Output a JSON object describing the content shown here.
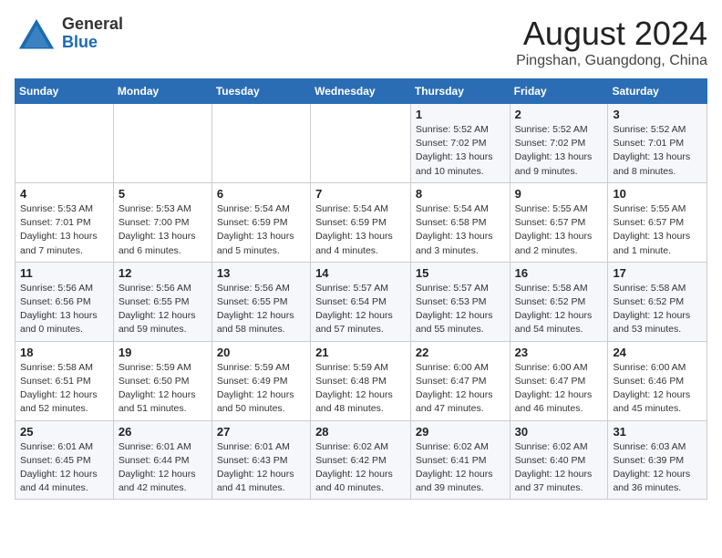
{
  "header": {
    "logo_general": "General",
    "logo_blue": "Blue",
    "title": "August 2024",
    "subtitle": "Pingshan, Guangdong, China"
  },
  "weekdays": [
    "Sunday",
    "Monday",
    "Tuesday",
    "Wednesday",
    "Thursday",
    "Friday",
    "Saturday"
  ],
  "weeks": [
    [
      {
        "day": "",
        "detail": ""
      },
      {
        "day": "",
        "detail": ""
      },
      {
        "day": "",
        "detail": ""
      },
      {
        "day": "",
        "detail": ""
      },
      {
        "day": "1",
        "detail": "Sunrise: 5:52 AM\nSunset: 7:02 PM\nDaylight: 13 hours and 10 minutes."
      },
      {
        "day": "2",
        "detail": "Sunrise: 5:52 AM\nSunset: 7:02 PM\nDaylight: 13 hours and 9 minutes."
      },
      {
        "day": "3",
        "detail": "Sunrise: 5:52 AM\nSunset: 7:01 PM\nDaylight: 13 hours and 8 minutes."
      }
    ],
    [
      {
        "day": "4",
        "detail": "Sunrise: 5:53 AM\nSunset: 7:01 PM\nDaylight: 13 hours and 7 minutes."
      },
      {
        "day": "5",
        "detail": "Sunrise: 5:53 AM\nSunset: 7:00 PM\nDaylight: 13 hours and 6 minutes."
      },
      {
        "day": "6",
        "detail": "Sunrise: 5:54 AM\nSunset: 6:59 PM\nDaylight: 13 hours and 5 minutes."
      },
      {
        "day": "7",
        "detail": "Sunrise: 5:54 AM\nSunset: 6:59 PM\nDaylight: 13 hours and 4 minutes."
      },
      {
        "day": "8",
        "detail": "Sunrise: 5:54 AM\nSunset: 6:58 PM\nDaylight: 13 hours and 3 minutes."
      },
      {
        "day": "9",
        "detail": "Sunrise: 5:55 AM\nSunset: 6:57 PM\nDaylight: 13 hours and 2 minutes."
      },
      {
        "day": "10",
        "detail": "Sunrise: 5:55 AM\nSunset: 6:57 PM\nDaylight: 13 hours and 1 minute."
      }
    ],
    [
      {
        "day": "11",
        "detail": "Sunrise: 5:56 AM\nSunset: 6:56 PM\nDaylight: 13 hours and 0 minutes."
      },
      {
        "day": "12",
        "detail": "Sunrise: 5:56 AM\nSunset: 6:55 PM\nDaylight: 12 hours and 59 minutes."
      },
      {
        "day": "13",
        "detail": "Sunrise: 5:56 AM\nSunset: 6:55 PM\nDaylight: 12 hours and 58 minutes."
      },
      {
        "day": "14",
        "detail": "Sunrise: 5:57 AM\nSunset: 6:54 PM\nDaylight: 12 hours and 57 minutes."
      },
      {
        "day": "15",
        "detail": "Sunrise: 5:57 AM\nSunset: 6:53 PM\nDaylight: 12 hours and 55 minutes."
      },
      {
        "day": "16",
        "detail": "Sunrise: 5:58 AM\nSunset: 6:52 PM\nDaylight: 12 hours and 54 minutes."
      },
      {
        "day": "17",
        "detail": "Sunrise: 5:58 AM\nSunset: 6:52 PM\nDaylight: 12 hours and 53 minutes."
      }
    ],
    [
      {
        "day": "18",
        "detail": "Sunrise: 5:58 AM\nSunset: 6:51 PM\nDaylight: 12 hours and 52 minutes."
      },
      {
        "day": "19",
        "detail": "Sunrise: 5:59 AM\nSunset: 6:50 PM\nDaylight: 12 hours and 51 minutes."
      },
      {
        "day": "20",
        "detail": "Sunrise: 5:59 AM\nSunset: 6:49 PM\nDaylight: 12 hours and 50 minutes."
      },
      {
        "day": "21",
        "detail": "Sunrise: 5:59 AM\nSunset: 6:48 PM\nDaylight: 12 hours and 48 minutes."
      },
      {
        "day": "22",
        "detail": "Sunrise: 6:00 AM\nSunset: 6:47 PM\nDaylight: 12 hours and 47 minutes."
      },
      {
        "day": "23",
        "detail": "Sunrise: 6:00 AM\nSunset: 6:47 PM\nDaylight: 12 hours and 46 minutes."
      },
      {
        "day": "24",
        "detail": "Sunrise: 6:00 AM\nSunset: 6:46 PM\nDaylight: 12 hours and 45 minutes."
      }
    ],
    [
      {
        "day": "25",
        "detail": "Sunrise: 6:01 AM\nSunset: 6:45 PM\nDaylight: 12 hours and 44 minutes."
      },
      {
        "day": "26",
        "detail": "Sunrise: 6:01 AM\nSunset: 6:44 PM\nDaylight: 12 hours and 42 minutes."
      },
      {
        "day": "27",
        "detail": "Sunrise: 6:01 AM\nSunset: 6:43 PM\nDaylight: 12 hours and 41 minutes."
      },
      {
        "day": "28",
        "detail": "Sunrise: 6:02 AM\nSunset: 6:42 PM\nDaylight: 12 hours and 40 minutes."
      },
      {
        "day": "29",
        "detail": "Sunrise: 6:02 AM\nSunset: 6:41 PM\nDaylight: 12 hours and 39 minutes."
      },
      {
        "day": "30",
        "detail": "Sunrise: 6:02 AM\nSunset: 6:40 PM\nDaylight: 12 hours and 37 minutes."
      },
      {
        "day": "31",
        "detail": "Sunrise: 6:03 AM\nSunset: 6:39 PM\nDaylight: 12 hours and 36 minutes."
      }
    ]
  ]
}
